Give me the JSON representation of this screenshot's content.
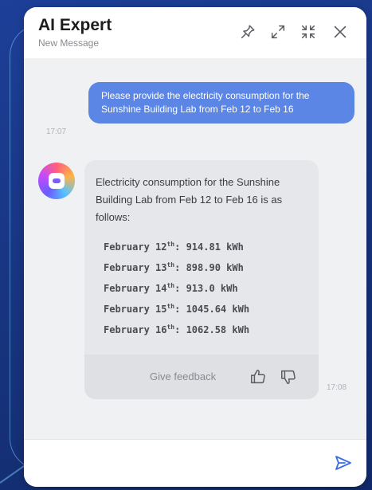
{
  "header": {
    "title": "AI Expert",
    "subtitle": "New Message",
    "icons": [
      "pin-icon",
      "expand-icon",
      "collapse-icon",
      "close-icon"
    ]
  },
  "conversation": {
    "user_message": {
      "text": "Please provide the electricity consumption for the Sunshine Building Lab from Feb 12 to Feb 16",
      "time": "17:07"
    },
    "ai_message": {
      "intro": "Electricity consumption for the Sunshine Building Lab from Feb 12 to Feb 16 is as follows:",
      "items": [
        {
          "day": "February 12",
          "suffix": "th",
          "value": ": 914.81 kWh"
        },
        {
          "day": "February 13",
          "suffix": "th",
          "value": ": 898.90 kWh"
        },
        {
          "day": "February 14",
          "suffix": "th",
          "value": ": 913.0 kWh"
        },
        {
          "day": "February 15",
          "suffix": "th",
          "value": ": 1045.64 kWh"
        },
        {
          "day": "February 16",
          "suffix": "th",
          "value": ": 1062.58 kWh"
        }
      ],
      "feedback_label": "Give feedback",
      "time": "17:08"
    }
  },
  "composer": {
    "value": "",
    "placeholder": ""
  },
  "colors": {
    "user_bubble": "#5b86e5",
    "accent": "#3b6fe0",
    "background": "#1d3f98"
  }
}
